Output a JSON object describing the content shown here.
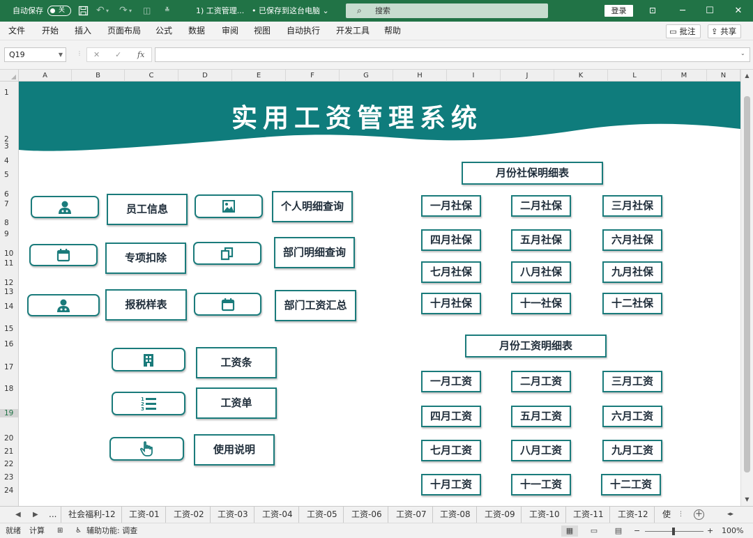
{
  "titlebar": {
    "autosave_label": "自动保存",
    "autosave_state": "关",
    "filename": "1) 工资管理...",
    "save_status": "• 已保存到这台电脑 ⌄",
    "search_placeholder": "搜索",
    "login_label": "登录"
  },
  "menu": [
    "文件",
    "开始",
    "插入",
    "页面布局",
    "公式",
    "数据",
    "审阅",
    "视图",
    "自动执行",
    "开发工具",
    "帮助"
  ],
  "ribbon_buttons": {
    "comment": "批注",
    "share": "共享"
  },
  "formula": {
    "name_box": "Q19",
    "fx": "fx",
    "cancel": "✕",
    "enter": "✓",
    "value": ""
  },
  "columns": [
    "A",
    "B",
    "C",
    "D",
    "E",
    "F",
    "G",
    "H",
    "I",
    "J",
    "K",
    "L",
    "M",
    "N"
  ],
  "rows": [
    "1",
    "2",
    "3",
    "4",
    "5",
    "6",
    "7",
    "8",
    "9",
    "10",
    "11",
    "12",
    "13",
    "14",
    "15",
    "16",
    "17",
    "18",
    "19",
    "20",
    "21",
    "22",
    "23",
    "24"
  ],
  "banner": {
    "title": "实用工资管理系统",
    "color": "#0f7c7c"
  },
  "accent_color": "#1a7b7b",
  "left_nav": {
    "employee_info": "员工信息",
    "special_deduction": "专项扣除",
    "tax_template": "报税样表",
    "personal_detail_query": "个人明细查询",
    "dept_detail_query": "部门明细查询",
    "dept_salary_summary": "部门工资汇总",
    "payslip": "工资条",
    "salary_sheet": "工资单",
    "instructions": "使用说明"
  },
  "icons": {
    "employee_info": "doctor-icon",
    "special_deduction": "calendar-icon",
    "tax_template": "doctor-icon",
    "personal_detail_query": "image-icon",
    "dept_detail_query": "copy-icon",
    "dept_salary_summary": "calendar-icon",
    "payslip": "building-icon",
    "salary_sheet": "numbered-list-icon",
    "instructions": "pointer-hand-icon"
  },
  "social_security": {
    "title": "月份社保明细表",
    "months": [
      "一月社保",
      "二月社保",
      "三月社保",
      "四月社保",
      "五月社保",
      "六月社保",
      "七月社保",
      "八月社保",
      "九月社保",
      "十月社保",
      "十一社保",
      "十二社保"
    ]
  },
  "salary": {
    "title": "月份工资明细表",
    "months": [
      "一月工资",
      "二月工资",
      "三月工资",
      "四月工资",
      "五月工资",
      "六月工资",
      "七月工资",
      "八月工资",
      "九月工资",
      "十月工资",
      "十一工资",
      "十二工资"
    ]
  },
  "sheet_tabs": [
    "...",
    "社会福利-12",
    "工资-01",
    "工资-02",
    "工资-03",
    "工资-04",
    "工资-05",
    "工资-06",
    "工资-07",
    "工资-08",
    "工资-09",
    "工资-10",
    "工资-11",
    "工资-12",
    "使"
  ],
  "status": {
    "ready": "就绪",
    "calc": "计算",
    "accessibility": "辅助功能: 调查",
    "zoom": "100%"
  }
}
